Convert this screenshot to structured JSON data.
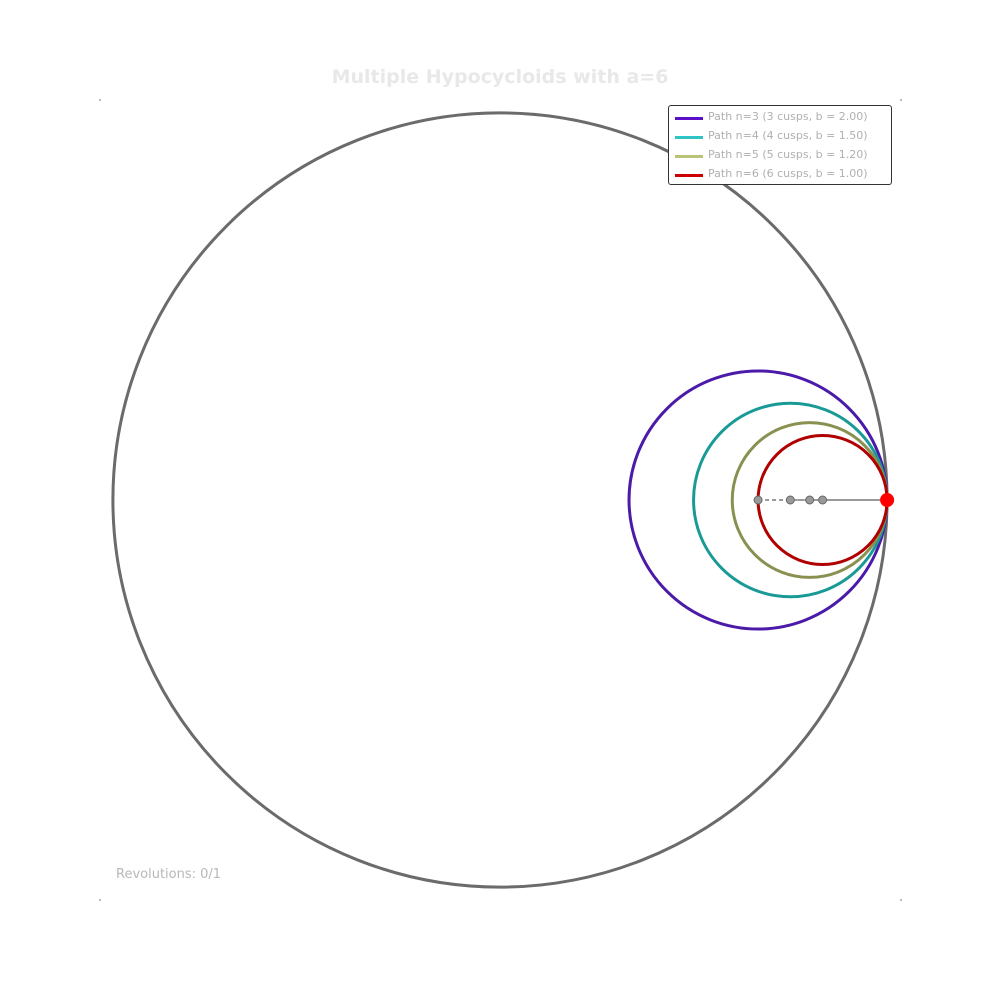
{
  "chart_data": {
    "type": "line",
    "title": "Multiple Hypocycloids with a=6",
    "fixed_circle": {
      "radius": 6,
      "color": "#6b6b6b"
    },
    "axis_limits": {
      "xlim": [
        -6.2,
        6.2
      ],
      "ylim": [
        -6.2,
        6.2
      ]
    },
    "grid": false,
    "axes_visible": false,
    "legend_position": "top-right",
    "series": [
      {
        "name": "Path n=3 (3 cusps, b = 2.00)",
        "a": 6,
        "b": 2.0,
        "color": "#5a0fc8",
        "line_color": "#4b1aa8"
      },
      {
        "name": "Path n=4 (4 cusps, b = 1.50)",
        "a": 6,
        "b": 1.5,
        "color": "#2ec4c4",
        "line_color": "#1a9a96"
      },
      {
        "name": "Path n=5 (5 cusps, b = 1.20)",
        "a": 6,
        "b": 1.2,
        "color": "#b9c277",
        "line_color": "#8a9050"
      },
      {
        "name": "Path n=6 (6 cusps, b = 1.00)",
        "a": 6,
        "b": 1.0,
        "color": "#cc0000",
        "line_color": "#b00000"
      }
    ],
    "tracing_point": {
      "x": 6,
      "y": 0,
      "color": "#ff0000"
    },
    "status_text": "Revolutions: 0/1"
  }
}
